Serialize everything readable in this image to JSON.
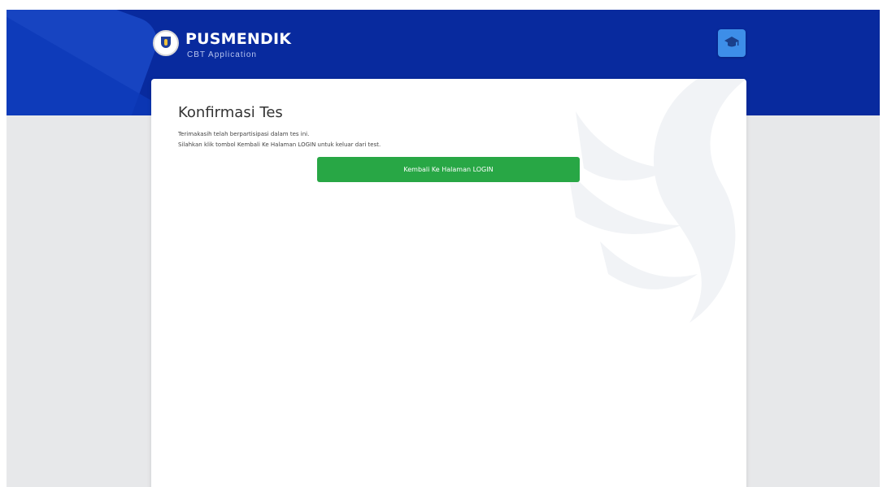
{
  "header": {
    "title": "PUSMENDIK",
    "subtitle": "CBT Application",
    "menu_icon": "graduation-cap-icon",
    "logo_icon": "emblem-logo"
  },
  "card": {
    "title": "Konfirmasi Tes",
    "line1": "Terimakasih telah berpartisipasi dalam tes ini.",
    "line2": "Silahkan klik tombol Kembali Ke Halaman LOGIN untuk keluar dari test.",
    "button_label": "Kembali Ke Halaman LOGIN"
  },
  "colors": {
    "header_bg": "#082a9e",
    "button_green": "#28a745",
    "page_bg": "#e7e8ea",
    "icon_button": "#3d8ee8"
  }
}
